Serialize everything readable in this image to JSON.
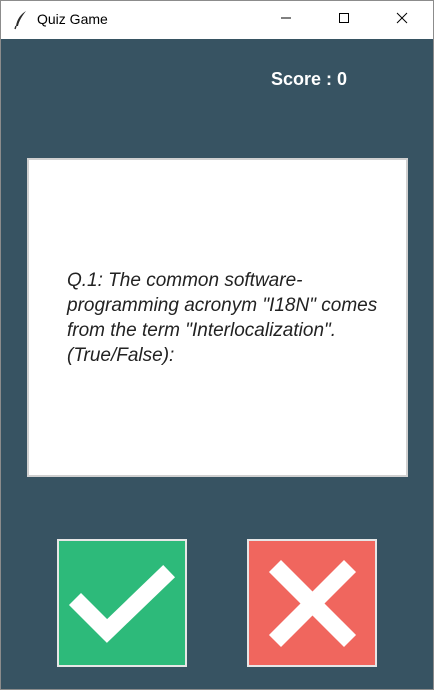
{
  "window": {
    "title": "Quiz Game",
    "icon": "feather-icon",
    "controls": [
      "minimize-icon",
      "maximize-icon",
      "close-icon"
    ]
  },
  "score": {
    "label": "Score : ",
    "value": "0"
  },
  "question": {
    "text": "Q.1: The common software-programming acronym \"I18N\" comes from the term \"Interlocalization\". (True/False):"
  },
  "answers": {
    "true_icon": "checkmark-icon",
    "false_icon": "cross-icon"
  },
  "colors": {
    "background": "#375362",
    "true_button": "#2dba7a",
    "false_button": "#f0665e",
    "card": "#ffffff"
  }
}
